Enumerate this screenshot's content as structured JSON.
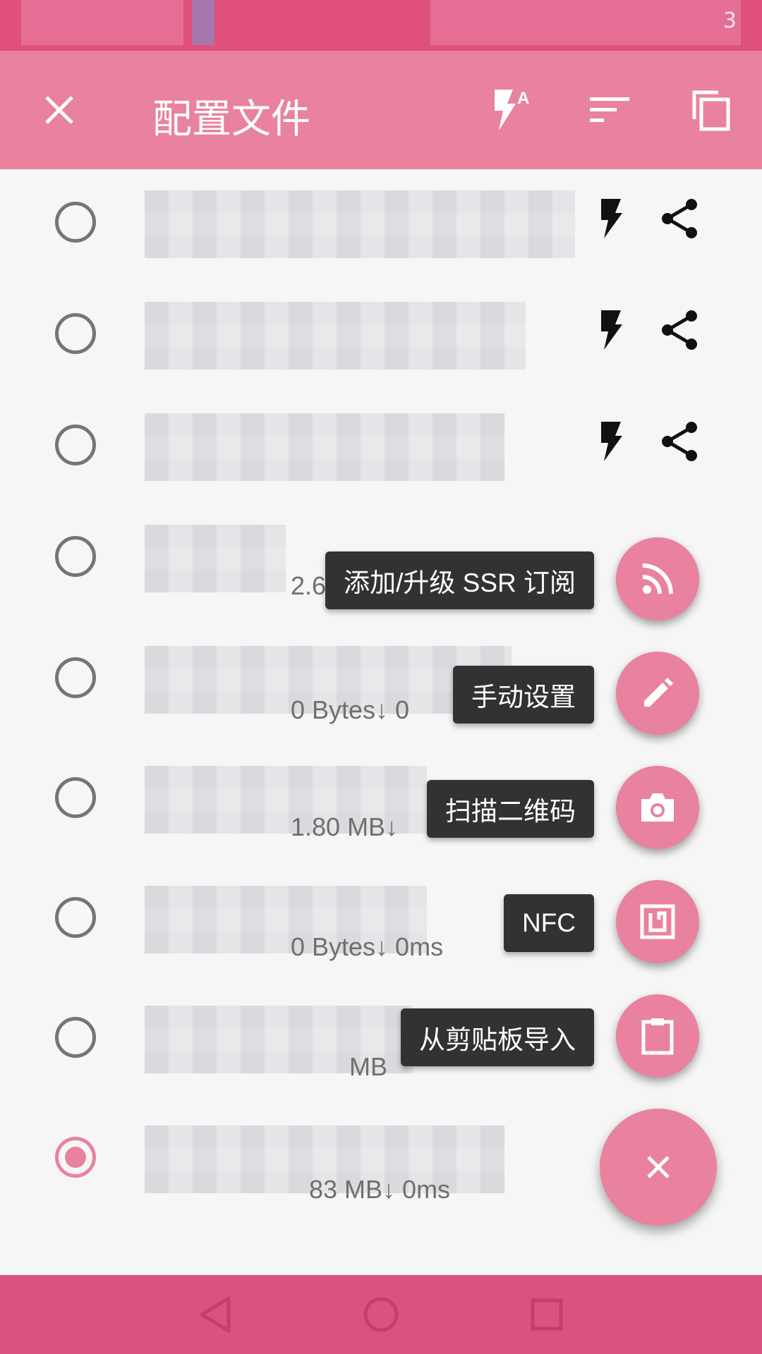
{
  "colors": {
    "status_bar": "#e0507d",
    "toolbar": "#e8829f",
    "accent": "#e8829f",
    "nav_bar": "#db5280",
    "tooltip_bg": "#323232"
  },
  "status_bar": {
    "indicator": "3"
  },
  "toolbar": {
    "title": "配置文件",
    "close_icon": "close-icon",
    "actions": [
      "bolt-a-icon",
      "sort-icon",
      "copy-icon"
    ]
  },
  "profiles": [
    {
      "selected": false,
      "stats": ""
    },
    {
      "selected": false,
      "stats": ""
    },
    {
      "selected": false,
      "stats": ""
    },
    {
      "selected": false,
      "stats": "2.60 GB↓ 0"
    },
    {
      "selected": false,
      "stats": "0 Bytes↓ 0"
    },
    {
      "selected": false,
      "stats": "1.80 MB↓"
    },
    {
      "selected": false,
      "stats": "0 Bytes↓  0ms"
    },
    {
      "selected": false,
      "stats": "MB"
    },
    {
      "selected": true,
      "stats": "83 MB↓  0ms"
    }
  ],
  "fab_menu": [
    {
      "label": "添加/升级 SSR 订阅",
      "icon": "rss-icon"
    },
    {
      "label": "手动设置",
      "icon": "pencil-icon"
    },
    {
      "label": "扫描二维码",
      "icon": "camera-icon"
    },
    {
      "label": "NFC",
      "icon": "nfc-icon"
    },
    {
      "label": "从剪贴板导入",
      "icon": "clipboard-icon"
    }
  ],
  "fab_main_icon": "close-icon",
  "nav_bar": [
    "back-icon",
    "home-icon",
    "recents-icon"
  ]
}
